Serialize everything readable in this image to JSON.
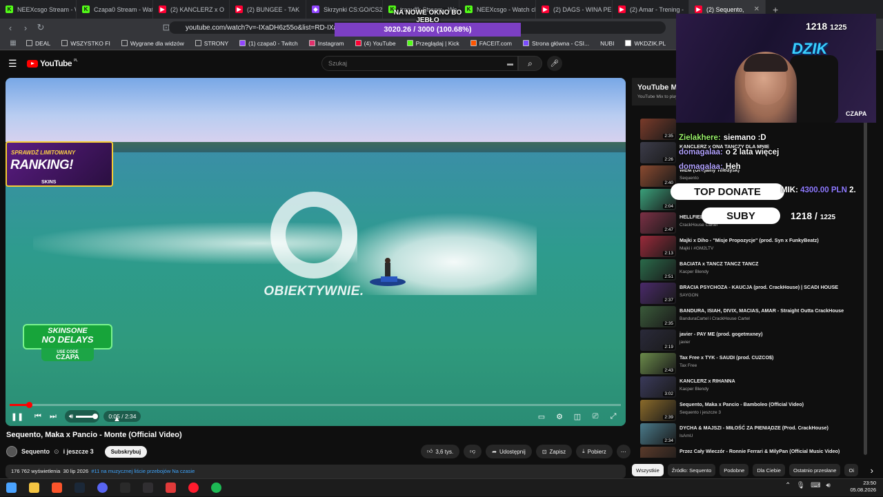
{
  "browser": {
    "tabs": [
      {
        "label": "NEEXcsgo Stream - W",
        "icon": "kick"
      },
      {
        "label": "Czapa0 Stream - Watc",
        "icon": "kick"
      },
      {
        "label": "(2) KANCLERZ x O",
        "icon": "youtube"
      },
      {
        "label": "(2) BUNGEE - TAK",
        "icon": "youtube"
      },
      {
        "label": "Skrzynki CS:GO/CS2 |",
        "icon": "twitch"
      },
      {
        "label": "tranuffk Stream - Wa",
        "icon": "kick"
      },
      {
        "label": "NEEXcsgo - Watch cli",
        "icon": "kick"
      },
      {
        "label": "(2) DAGS - WINA PED",
        "icon": "youtube"
      },
      {
        "label": "(2) Amar - Trening -",
        "icon": "youtube"
      },
      {
        "label": "(2) Sequento,",
        "icon": "youtube",
        "active": true
      }
    ],
    "url": "youtube.com/watch?v=-IXaDH6z55o&list=RD-IXaDH",
    "bookmarks": [
      {
        "label": "DEAL",
        "icon": "folder"
      },
      {
        "label": "WSZYSTKO FI",
        "icon": "folder"
      },
      {
        "label": "Wygrane dla widzów",
        "icon": "folder"
      },
      {
        "label": "STRONY",
        "icon": "folder"
      },
      {
        "label": "(1) czapa0 - Twitch",
        "icon": "twitch"
      },
      {
        "label": "Instagram",
        "icon": "instagram"
      },
      {
        "label": "(4) YouTube",
        "icon": "youtube"
      },
      {
        "label": "Przeglądaj | Kick",
        "icon": "kick"
      },
      {
        "label": "FACEIT.com",
        "icon": "faceit"
      },
      {
        "label": "Strona główna - CSI...",
        "icon": "csi"
      },
      {
        "label": "NUBI",
        "icon": "none"
      },
      {
        "label": "WKDZIK.PL",
        "icon": "wkdzik"
      },
      {
        "label": "Skrzynki CS:GO/CS",
        "icon": "twitch"
      }
    ]
  },
  "youtube": {
    "logo": "YouTube",
    "logo_region": "PL",
    "search_placeholder": "Szukaj",
    "video": {
      "title": "Sequento, Maka x Pancio - Monte (Official Video)",
      "time": "0:05 / 2:34",
      "progress": 0.032,
      "volume": 0.85,
      "watermark": "OBIEKTYWNIE."
    },
    "channel": {
      "name": "Sequento",
      "collab": "i jeszcze 3",
      "subscribe": "Subskrybuj"
    },
    "actions": {
      "likes": "3,6 tys.",
      "share": "Udostępnij",
      "save": "Zapisz",
      "download": "Pobierz"
    },
    "description": {
      "views": "176 762 wyświetlenia",
      "date": "30 lip 2026",
      "tags": "#11 na muzycznej liście przebojów Na czasie"
    },
    "mix": {
      "title": "YouTube Mi",
      "subtitle": "YouTube Mix to play"
    },
    "playlist": [
      {
        "title": "",
        "channel": "",
        "duration": "2:35",
        "color": "#7a3b2a"
      },
      {
        "title": "KANCLERZ x ONA TANCZY DLA MNIE",
        "channel": "",
        "duration": "2:26",
        "color": "#3c3c4a"
      },
      {
        "title": "WEM (Oficjalny Teledysk)",
        "channel": "Sequento",
        "duration": "2:40",
        "color": "#8a4a30"
      },
      {
        "title": "",
        "channel": "Malik Montana",
        "duration": "2:04",
        "color": "#3aa07a"
      },
      {
        "title": "HELLFIEL",
        "channel": "CrackHouse Cartel",
        "duration": "2:47",
        "color": "#7b3045"
      },
      {
        "title": "Majki x Diho - \"Misje Propozycje\" (prod. Syn x FunkyBeatz)",
        "channel": "Majki i #GM2LTV",
        "duration": "2:13",
        "color": "#9a2a3a"
      },
      {
        "title": "BACIATA x TANCZ TANCZ TANCZ",
        "channel": "Kacper Blendy",
        "duration": "2:51",
        "color": "#2a6a4a"
      },
      {
        "title": "BRACIA PSYCHOZA - KAUCJA (prod. CrackHouse) | SCADI HOUSE",
        "channel": "SAYGON",
        "duration": "2:37",
        "color": "#4a2a6a"
      },
      {
        "title": "BANDURA, ISIAH, DIVIX, MACIAS, AMAR - Straight Outta CrackHouse",
        "channel": "BanduraCartel i CrackHouse Cartel",
        "duration": "2:35",
        "color": "#3a5a3a"
      },
      {
        "title": "javier - PAY ME (prod. gogetmxney)",
        "channel": "javier",
        "duration": "2:19",
        "color": "#2a2a3a"
      },
      {
        "title": "Tax Free x TYK - SAUDI (prod. CUZCO$)",
        "channel": "Tax Free",
        "duration": "2:43",
        "color": "#6a8a4a"
      },
      {
        "title": "KANCLERZ x RIHANNA",
        "channel": "Kacper Blendy",
        "duration": "3:02",
        "color": "#3a3a5a"
      },
      {
        "title": "Sequento, Maka x Pancio - Bamboleo (Official Video)",
        "channel": "Sequento i jeszcze 3",
        "duration": "2:39",
        "color": "#8a6a2a"
      },
      {
        "title": "DYCHA & MAJSZI - MIŁOŚĆ ZA PIENIĄDZE (Prod. CrackHouse)",
        "channel": "IsAmU",
        "duration": "2:34",
        "color": "#4a7a8a"
      },
      {
        "title": "Przez Cały Wieczór - Ronnie Ferrari & MilyPan (Official Music Video)",
        "channel": "",
        "duration": "",
        "color": "#5a3a2a"
      }
    ],
    "chips": [
      "Wszystkie",
      "Źródło: Sequento",
      "Podobne",
      "Dla Ciebie",
      "Ostatnio przesłane",
      "Oi"
    ]
  },
  "overlay": {
    "top_text": "NA NOWE OKNO BO JEBŁO",
    "goal": "3020.26 / 3000 (100.68%)",
    "sub_count": "1218",
    "sub_goal": "1225",
    "brand": "DZIK",
    "streamer": "CZAPA",
    "ranking_l1": "SPRAWDŹ LIMITOWANY",
    "ranking_l2": "RANKING!",
    "ranking_l3": "SKINS",
    "skinsone_a": "SKINSONE",
    "skinsone_b": "NO DELAYS",
    "skinsone_c": "USE CODE",
    "skinsone_code": "CZAPA",
    "chat": [
      {
        "user": "",
        "msg": ""
      },
      {
        "user": "Zielakhere:",
        "msg": "siemano :D"
      },
      {
        "user": "domagalaa:",
        "msg": "o 2 lata więcej"
      },
      {
        "user": "domagalaa:",
        "msg": "Heh"
      }
    ],
    "top_donate_label": "TOP DONATE",
    "top_donate_name": "MIK:",
    "top_donate_amount": "4300.00 PLN",
    "top_donate_extra": "2.",
    "suby_label": "SUBY",
    "suby_count": "1218",
    "suby_goal": "1225"
  },
  "taskbar": {
    "time": "23:50",
    "date": "05.08.2026",
    "apps": [
      "start",
      "explorer",
      "brave",
      "steam",
      "discord",
      "epic",
      "obs",
      "adobe",
      "opera",
      "spotify"
    ]
  }
}
